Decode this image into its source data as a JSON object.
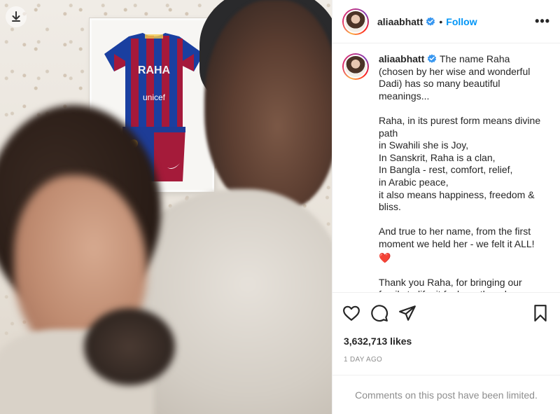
{
  "post": {
    "username": "aliaabhatt",
    "follow_label": "Follow",
    "separator": "•",
    "more_label": "•••",
    "caption": {
      "username": "aliaabhatt",
      "lines": [
        "The name Raha (chosen by her wise and wonderful Dadi) has so many beautiful meanings...",
        "",
        "Raha, in its purest form means divine path",
        "in Swahili she is Joy,",
        "In Sanskrit, Raha is a clan,",
        "In Bangla - rest, comfort, relief,",
        "in Arabic peace,",
        "it also means happiness, freedom & bliss.",
        "",
        "And true to her name, from the first moment we held her - we felt it ALL!",
        "❤️",
        "",
        "Thank you Raha, for bringing our family to life, it feels as though our life has only just begun 🌟🌟🌟"
      ]
    },
    "likes": "3,632,713 likes",
    "timestamp": "1 DAY AGO",
    "comments_limited": "Comments on this post have been limited.",
    "photo": {
      "jersey_text": "RAHA",
      "sponsor_text": "unicef"
    }
  },
  "colors": {
    "accent": "#0095f6",
    "verified": "#3897f0",
    "muted": "#8e8e8e",
    "border": "#efefef"
  },
  "icons": [
    "download-icon",
    "verified-badge-icon",
    "more-options-icon",
    "heart-icon",
    "comment-icon",
    "share-icon",
    "bookmark-icon"
  ]
}
